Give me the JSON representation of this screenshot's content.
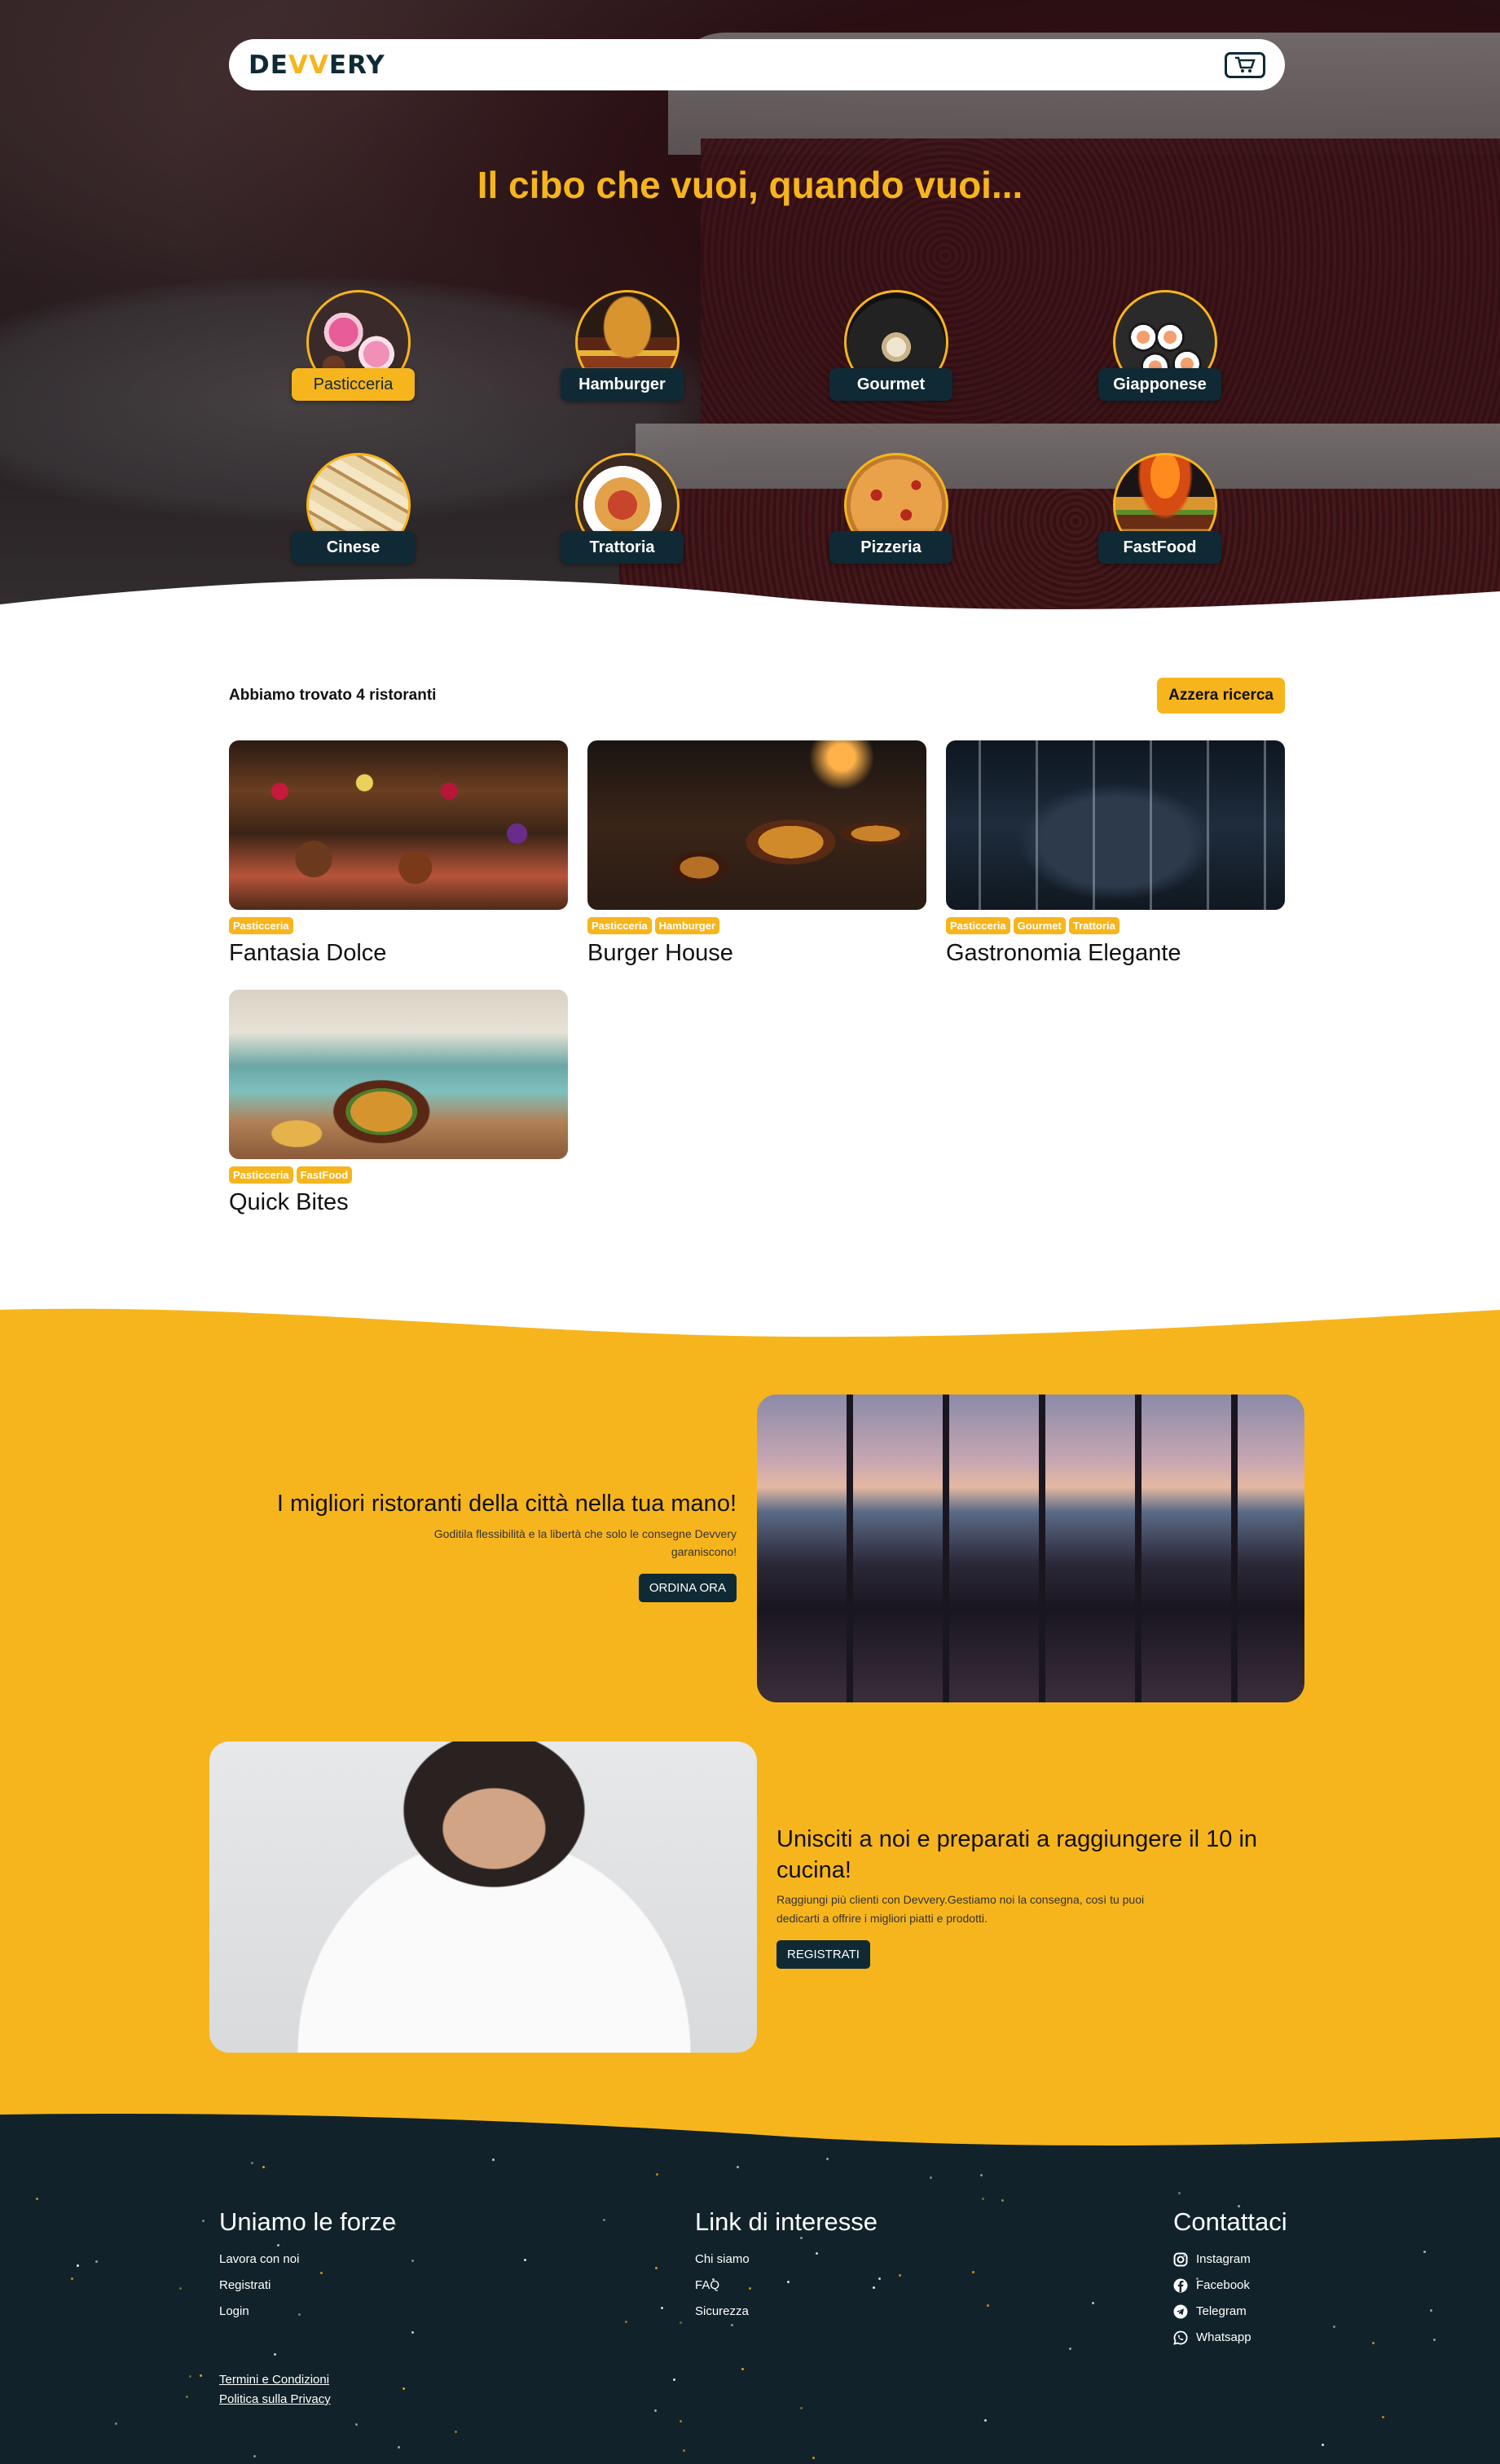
{
  "brand": {
    "logo_pre": "DE",
    "logo_w": "VV",
    "logo_post": "ERY",
    "accent": "#f7b51d",
    "dark": "#0f2a35"
  },
  "hero": {
    "title": "Il cibo che vuoi, quando vuoi..."
  },
  "categories": [
    {
      "label": "Pasticceria",
      "active": true,
      "icon": "donuts"
    },
    {
      "label": "Hamburger",
      "active": false,
      "icon": "burger"
    },
    {
      "label": "Gourmet",
      "active": false,
      "icon": "gourmet-dish"
    },
    {
      "label": "Giapponese",
      "active": false,
      "icon": "sushi"
    },
    {
      "label": "Cinese",
      "active": false,
      "icon": "spring-rolls"
    },
    {
      "label": "Trattoria",
      "active": false,
      "icon": "pasta"
    },
    {
      "label": "Pizzeria",
      "active": false,
      "icon": "pizza"
    },
    {
      "label": "FastFood",
      "active": false,
      "icon": "burger-fire"
    }
  ],
  "results": {
    "count_text": "Abbiamo trovato 4 ristoranti",
    "reset_label": "Azzera ricerca",
    "restaurants": [
      {
        "name": "Fantasia Dolce",
        "tags": [
          "Pasticceria"
        ]
      },
      {
        "name": "Burger House",
        "tags": [
          "Pasticceria",
          "Hamburger"
        ]
      },
      {
        "name": "Gastronomia Elegante",
        "tags": [
          "Pasticceria",
          "Gourmet",
          "Trattoria"
        ]
      },
      {
        "name": "Quick Bites",
        "tags": [
          "Pasticceria",
          "FastFood"
        ]
      }
    ]
  },
  "promo1": {
    "title": "I migliori ristoranti della città nella tua mano!",
    "subtitle": "Goditila flessibilità e la libertà che solo le consegne Devvery garaniscono!",
    "button": "ORDINA ORA"
  },
  "promo2": {
    "title": "Unisciti a noi e preparati a raggiungere il 10 in cucina!",
    "subtitle": "Raggiungi più clienti con Devvery.Gestiamo noi la consegna, così tu puoi dedicarti a offrire i migliori piatti e prodotti.",
    "button": "REGISTRATI"
  },
  "footer": {
    "col1": {
      "title": "Uniamo le forze",
      "links": [
        "Lavora con noi",
        "Registrati",
        "Login"
      ]
    },
    "col2": {
      "title": "Link di interesse",
      "links": [
        "Chi siamo",
        "FAQ",
        "Sicurezza"
      ]
    },
    "col3": {
      "title": "Contattaci",
      "links": [
        {
          "label": "Instagram",
          "icon": "instagram"
        },
        {
          "label": "Facebook",
          "icon": "facebook"
        },
        {
          "label": "Telegram",
          "icon": "telegram"
        },
        {
          "label": "Whatsapp",
          "icon": "whatsapp"
        }
      ]
    },
    "legal": [
      "Termini e Condizioni",
      "Politica sulla Privacy"
    ]
  }
}
